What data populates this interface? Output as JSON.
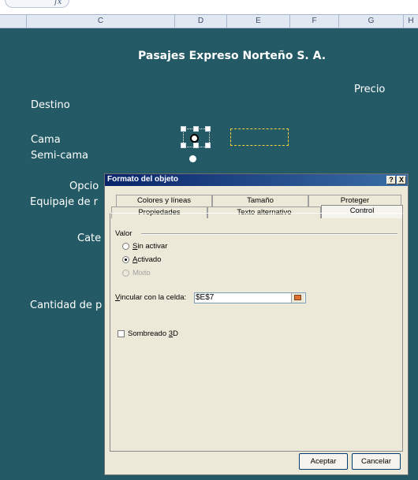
{
  "spreadsheet": {
    "formula_icon": "fx",
    "columns": [
      "C",
      "D",
      "E",
      "F",
      "G",
      "H"
    ],
    "cells": {
      "title": "Pasajes Expreso Norteño S. A.",
      "precio": "Precio",
      "destino": "Destino",
      "cama": "Cama",
      "semi_cama": "Semi-cama",
      "opciones": "Opcio",
      "equipaje": "Equipaje de r",
      "categoria": "Cate",
      "cantidad": "Cantidad de p"
    }
  },
  "dialog": {
    "title": "Formato del objeto",
    "help_button": "?",
    "close_button": "X",
    "tabs_row1": [
      "Colores y líneas",
      "Tamaño",
      "Proteger"
    ],
    "tabs_row2": [
      "Propiedades",
      "Texto alternativo",
      "Control"
    ],
    "active_tab": "Control",
    "group_valor": "Valor",
    "options": [
      {
        "mnemonic": "S",
        "rest": "in activar"
      },
      {
        "mnemonic": "A",
        "rest": "ctivado"
      },
      {
        "mnemonic": "",
        "rest": "Mixto"
      }
    ],
    "selected_option": "Activado",
    "link_label_mnemonic": "V",
    "link_label_rest": "incular con la celda:",
    "link_value": "$E$7",
    "shading_label_pre": "Sombreado ",
    "shading_mnemonic": "3",
    "shading_label_post": "D",
    "ok_button": "Aceptar",
    "cancel_button": "Cancelar"
  },
  "colors": {
    "sheet_background": "#235a65",
    "titlebar": "#0a246a",
    "dialog_face": "#ece9d8"
  },
  "icons": [
    "formula-fx-icon",
    "radio-button-icon",
    "cell-picker-icon",
    "help-icon",
    "close-icon"
  ]
}
